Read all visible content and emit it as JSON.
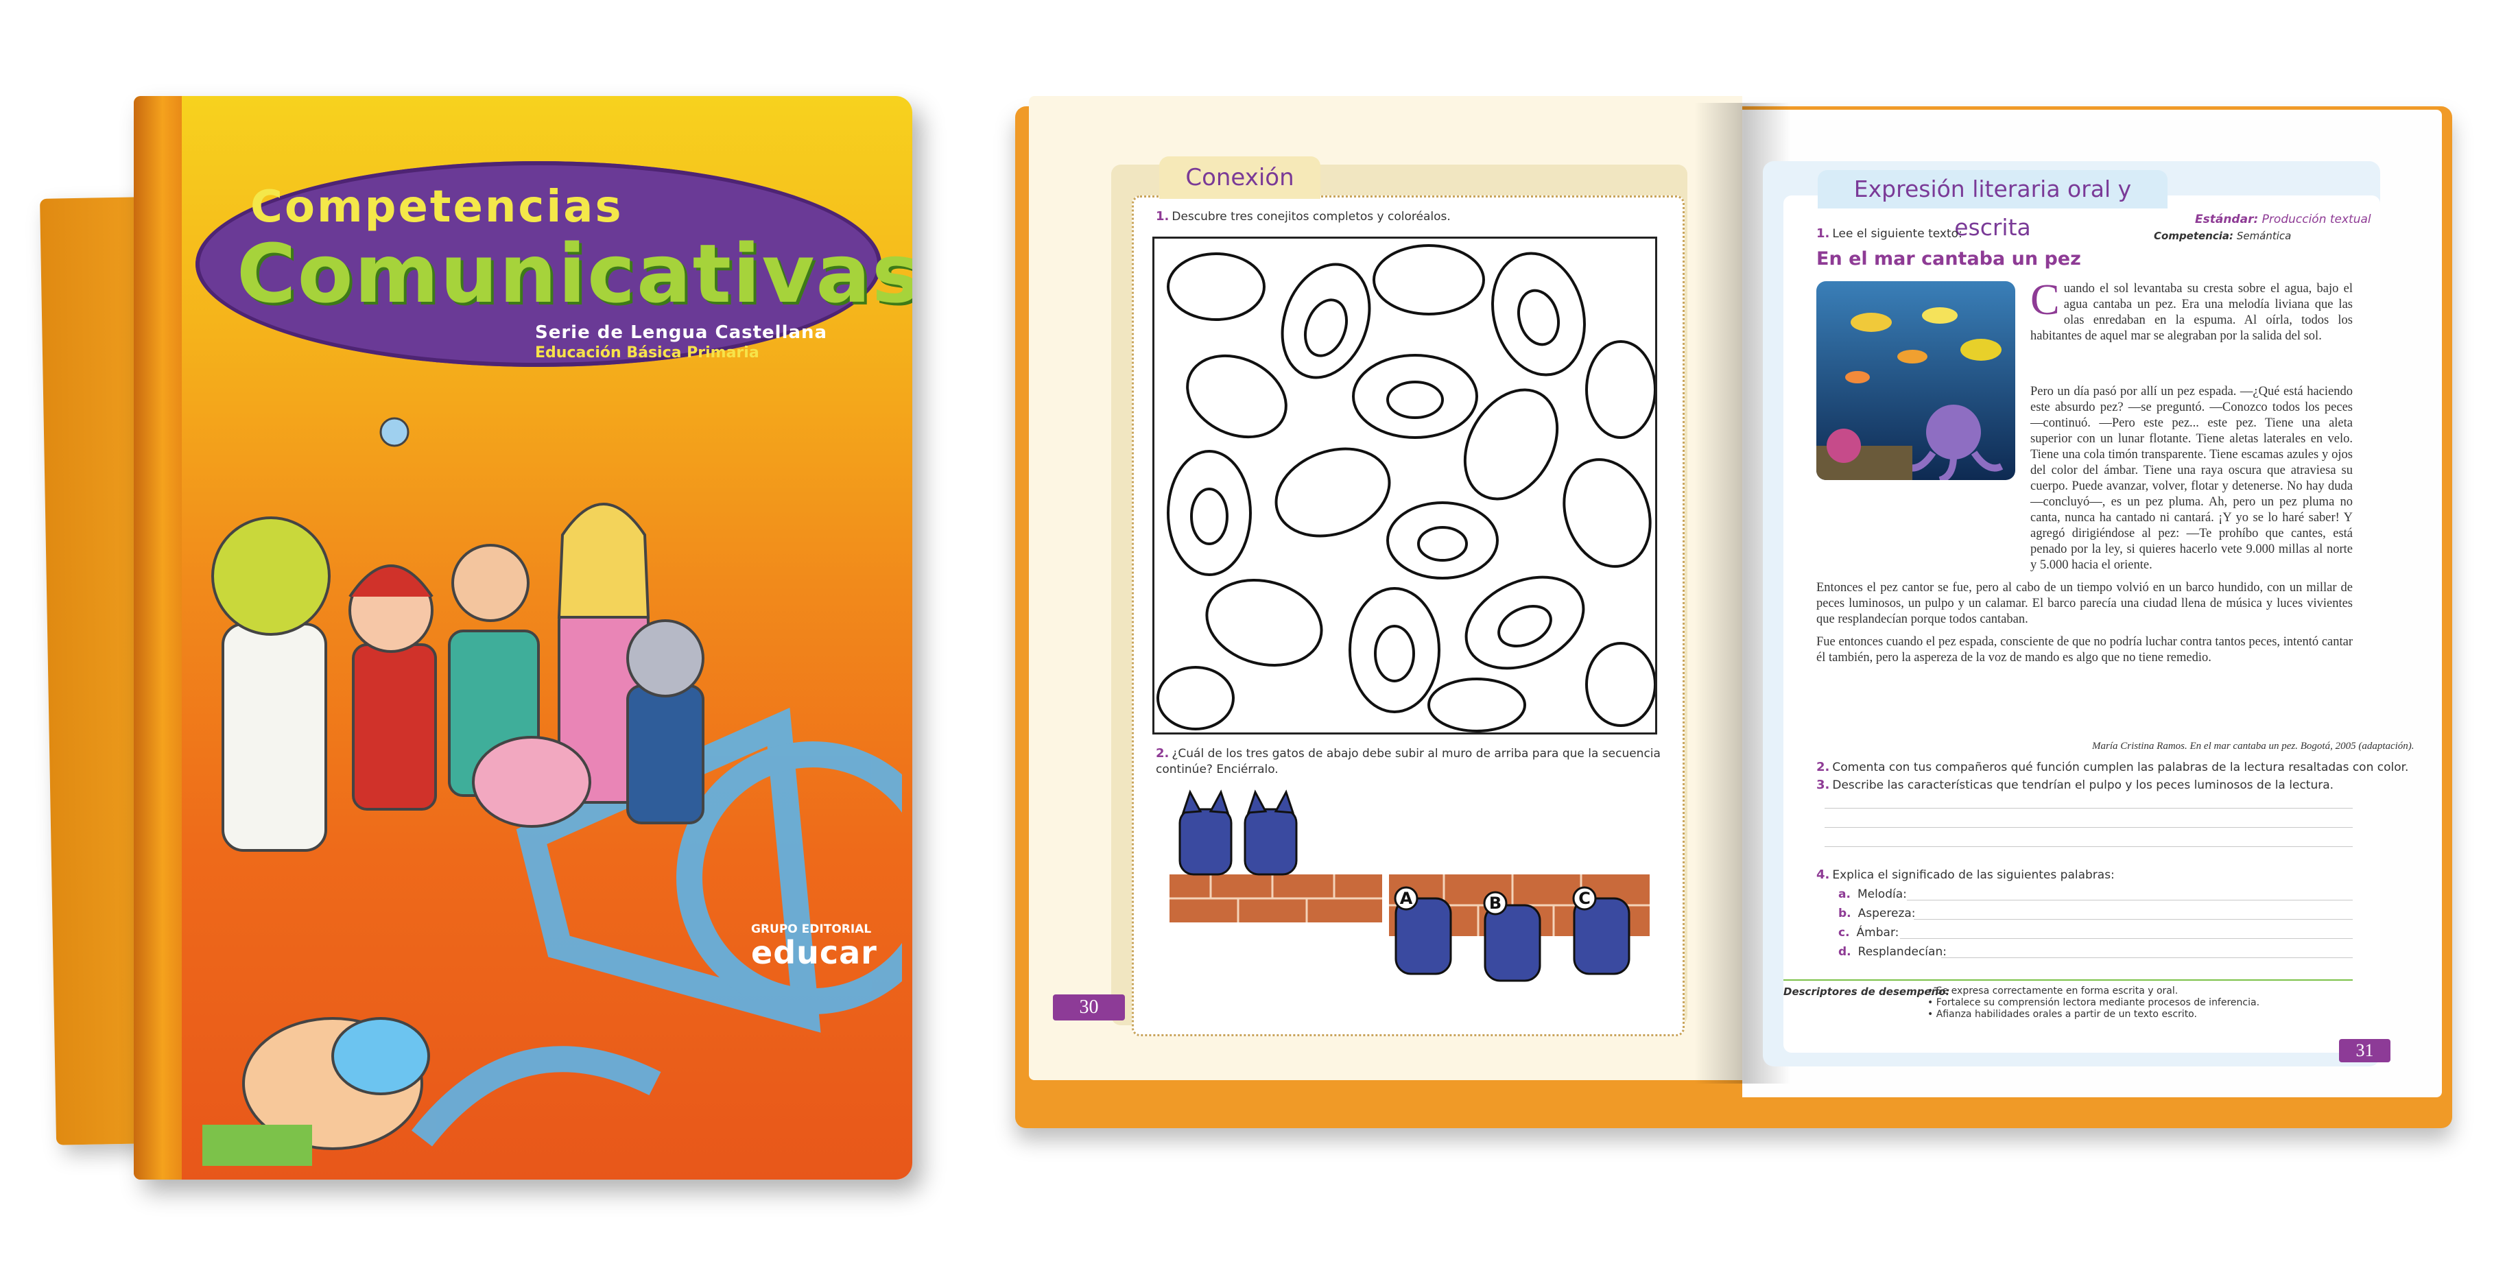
{
  "colors": {
    "accent_purple": "#8e3b95",
    "cover_orange": "#ee6a1a",
    "cover_yellow": "#f7d21e",
    "oval_purple": "#6a3a96",
    "title_green": "#a6d33b",
    "highlight_red": "#c0392b"
  },
  "cover": {
    "title_line1": "Competencias",
    "title_line2": "Comunicativas",
    "series": "Serie de Lengua Castellana",
    "level": "Educación Básica Primaria",
    "publisher_small": "GRUPO EDITORIAL",
    "publisher_big": "educar"
  },
  "left_page": {
    "section_tab": "Conexión",
    "q1_num": "1.",
    "q1_text": "Descubre tres conejitos completos y coloréalos.",
    "q2_num": "2.",
    "q2_text": "¿Cuál de los tres gatos de abajo debe subir al muro de arriba para que la secuencia continúe? Enciérralo.",
    "options": [
      "A",
      "B",
      "C"
    ],
    "page_number": "30"
  },
  "right_page": {
    "section_tab": "Expresión literaria oral y escrita",
    "estandar_label": "Estándar:",
    "estandar_value": "Producción textual",
    "competencia_label": "Competencia:",
    "competencia_value": "Semántica",
    "q1_num": "1.",
    "q1_text": "Lee el siguiente texto:",
    "story_title": "En el mar cantaba un pez",
    "story_dropcap": "C",
    "story_p1": "uando el sol levantaba su cresta sobre el agua, bajo el agua cantaba un pez. Era una melodía liviana que las olas enredaban en la espuma. Al oírla, todos los habitantes de aquel mar se alegraban por la salida del sol.",
    "story_p2": "Pero un día pasó por allí un pez espada. —¿Qué está haciendo este absurdo pez? —se preguntó. —Conozco todos los peces —continuó. —Pero este pez... este pez. Tiene una aleta superior con un lunar flotante. Tiene aletas laterales en velo. Tiene una cola timón transparente. Tiene escamas azules y ojos del color del ámbar. Tiene una raya oscura que atraviesa su cuerpo. Puede avanzar, volver, flotar y detenerse. No hay duda —concluyó—, es un pez pluma. Ah, pero un pez pluma no canta, nunca ha cantado ni cantará. ¡Y yo se lo haré saber! Y agregó dirigiéndose al pez: —Te prohíbo que cantes, está penado por la ley, si quieres hacerlo vete 9.000 millas al norte y 5.000 hacia el oriente.",
    "story_p3": "Entonces el pez cantor se fue, pero al cabo de un tiempo volvió en un barco hundido, con un millar de peces luminosos, un pulpo y un calamar. El barco parecía una ciudad llena de música y luces vivientes que resplandecían porque todos cantaban.",
    "story_p4": "Fue entonces cuando el pez espada, consciente de que no podría luchar contra tantos peces, intentó cantar él también, pero la aspereza de la voz de mando es algo que no tiene remedio.",
    "citation": "María Cristina Ramos. En el mar cantaba un pez. Bogotá, 2005 (adaptación).",
    "q2_num": "2.",
    "q2_text": "Comenta con tus compañeros qué función cumplen las palabras de la lectura resaltadas con color.",
    "q3_num": "3.",
    "q3_text": "Describe las características que tendrían el pulpo y los peces luminosos de la lectura.",
    "q4_num": "4.",
    "q4_text": "Explica el significado de las siguientes palabras:",
    "vocab": [
      {
        "letter": "a.",
        "word": "Melodía:"
      },
      {
        "letter": "b.",
        "word": "Aspereza:"
      },
      {
        "letter": "c.",
        "word": "Ámbar:"
      },
      {
        "letter": "d.",
        "word": "Resplandecían:"
      }
    ],
    "descriptores_label": "Descriptores de desempeño:",
    "descriptores": [
      "Se expresa correctamente en forma escrita y oral.",
      "Fortalece su comprensión lectora mediante procesos de inferencia.",
      "Afianza habilidades orales a partir de un texto escrito."
    ],
    "page_number": "31"
  }
}
